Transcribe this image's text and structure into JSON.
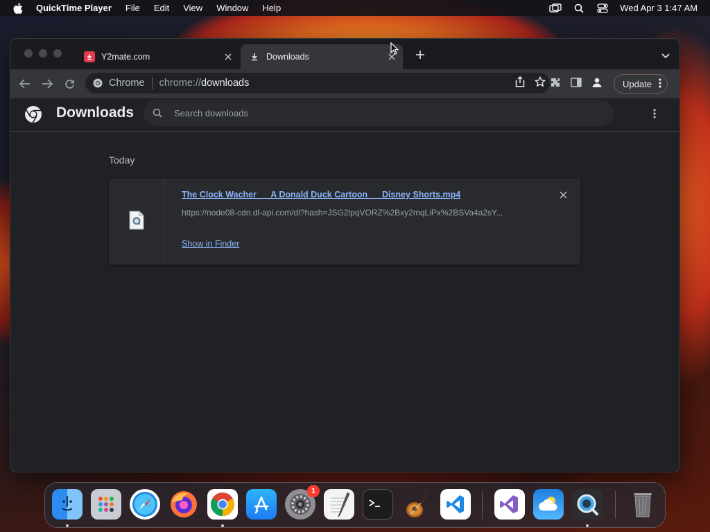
{
  "menubar": {
    "app_name": "QuickTime Player",
    "menus": [
      "File",
      "Edit",
      "View",
      "Window",
      "Help"
    ],
    "datetime": "Wed Apr 3  1:47 AM"
  },
  "browser": {
    "tabs": [
      {
        "title": "Y2mate.com",
        "icon": "y2mate-favicon",
        "active": false
      },
      {
        "title": "Downloads",
        "icon": "download-icon",
        "active": true
      }
    ],
    "omnibox": {
      "chip": "Chrome",
      "scheme": "chrome://",
      "host": "downloads"
    },
    "update_label": "Update"
  },
  "downloads": {
    "title": "Downloads",
    "search_placeholder": "Search downloads",
    "date_group": "Today",
    "items": [
      {
        "filename": "The Clock Wacher __ A Donald Duck Cartoon __ Disney Shorts.mp4",
        "url": "https://node08-cdn.dl-api.com/dl?hash=JSG2lpqVORZ%2Bxy2mqLiPx%2BSVa4a2sY...",
        "action": "Show in Finder"
      }
    ]
  },
  "dock": {
    "apps": [
      "Finder",
      "Launchpad",
      "Safari",
      "Firefox",
      "Chrome",
      "App Store",
      "System Preferences",
      "TextEdit",
      "Terminal",
      "GarageBand",
      "Visual Studio Code",
      "Visual Studio",
      "Weather",
      "QuickTime Player",
      "Trash"
    ],
    "badge_system_prefs": "1"
  }
}
